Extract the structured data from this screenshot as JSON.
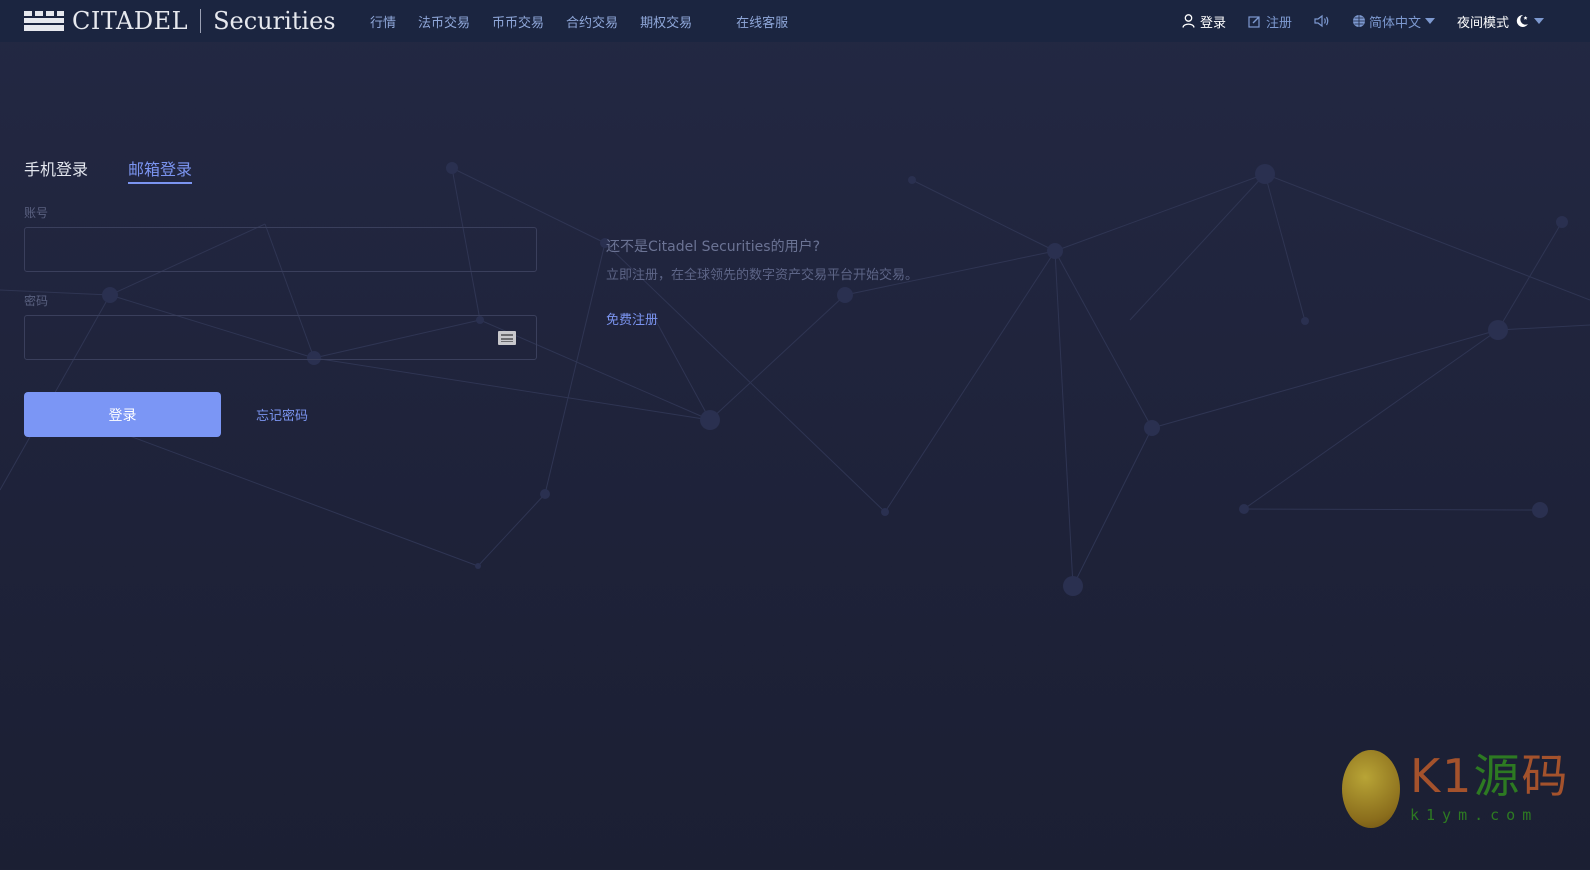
{
  "header": {
    "logo": {
      "brand": "CITADEL",
      "sub": "Securities"
    },
    "nav": [
      {
        "label": "行情"
      },
      {
        "label": "法币交易"
      },
      {
        "label": "币币交易"
      },
      {
        "label": "合约交易"
      },
      {
        "label": "期权交易"
      },
      {
        "label": "在线客服"
      }
    ],
    "right": {
      "login": "登录",
      "register": "注册",
      "sound_icon": "speaker-icon",
      "language": "简体中文",
      "night_mode": "夜间模式"
    }
  },
  "login_form": {
    "tabs": [
      {
        "label": "手机登录",
        "active": false
      },
      {
        "label": "邮箱登录",
        "active": true
      }
    ],
    "account_label": "账号",
    "account_value": "",
    "password_label": "密码",
    "password_value": "",
    "keyboard_icon": "keyboard-icon",
    "submit": "登录",
    "forgot": "忘记密码"
  },
  "promo": {
    "question": "还不是Citadel Securities的用户?",
    "description": "立即注册，在全球领先的数字资产交易平台开始交易。",
    "link": "免费注册"
  },
  "watermark": {
    "title_a": "K1",
    "title_b": "源",
    "title_c": "码",
    "url": "k1ym.com"
  },
  "colors": {
    "accent": "#7b94f0",
    "button": "#7b96f5",
    "topbar": "#1b2540",
    "background": "#1f2339"
  }
}
